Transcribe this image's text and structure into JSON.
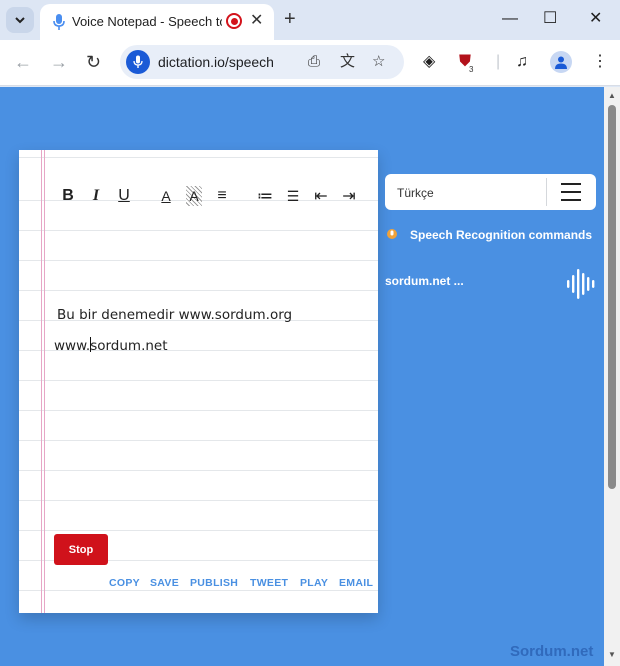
{
  "browser": {
    "tab": {
      "title": "Voice Notepad - Speech to"
    },
    "address": {
      "url": "dictation.io/speech"
    },
    "extension_badge": "3"
  },
  "toolbar": {
    "formatting": [
      {
        "name": "bold-icon",
        "glyph": "B"
      },
      {
        "name": "italic-icon",
        "glyph": "I"
      },
      {
        "name": "underline-icon",
        "glyph": "U"
      },
      {
        "name": "text-color-icon",
        "glyph": "A"
      },
      {
        "name": "highlight-icon",
        "glyph": "A"
      },
      {
        "name": "align-icon",
        "glyph": "≡"
      },
      {
        "name": "ordered-list-icon",
        "glyph": "≔"
      },
      {
        "name": "bullet-list-icon",
        "glyph": "☰"
      },
      {
        "name": "outdent-icon",
        "glyph": "⇤"
      },
      {
        "name": "indent-icon",
        "glyph": "⇥"
      }
    ]
  },
  "notepad": {
    "line1": "Bu bir denemedir www.sordum.org",
    "line2_before_caret": "www.",
    "line2_after_caret": "sordum.net",
    "stop_label": "Stop",
    "actions": {
      "copy": "COPY",
      "save": "SAVE",
      "publish": "PUBLISH",
      "tweet": "TWEET",
      "play": "PLAY",
      "email": "EMAIL"
    }
  },
  "panel": {
    "language": "Türkçe",
    "commands_link": "Speech Recognition commands",
    "transcript": "sordum.net ..."
  },
  "watermark": "Sordum.net",
  "colors": {
    "page_bg": "#4a90e2",
    "stop": "#d0121b",
    "link": "#4a90e2",
    "margin_line": "#e7a6c6"
  }
}
